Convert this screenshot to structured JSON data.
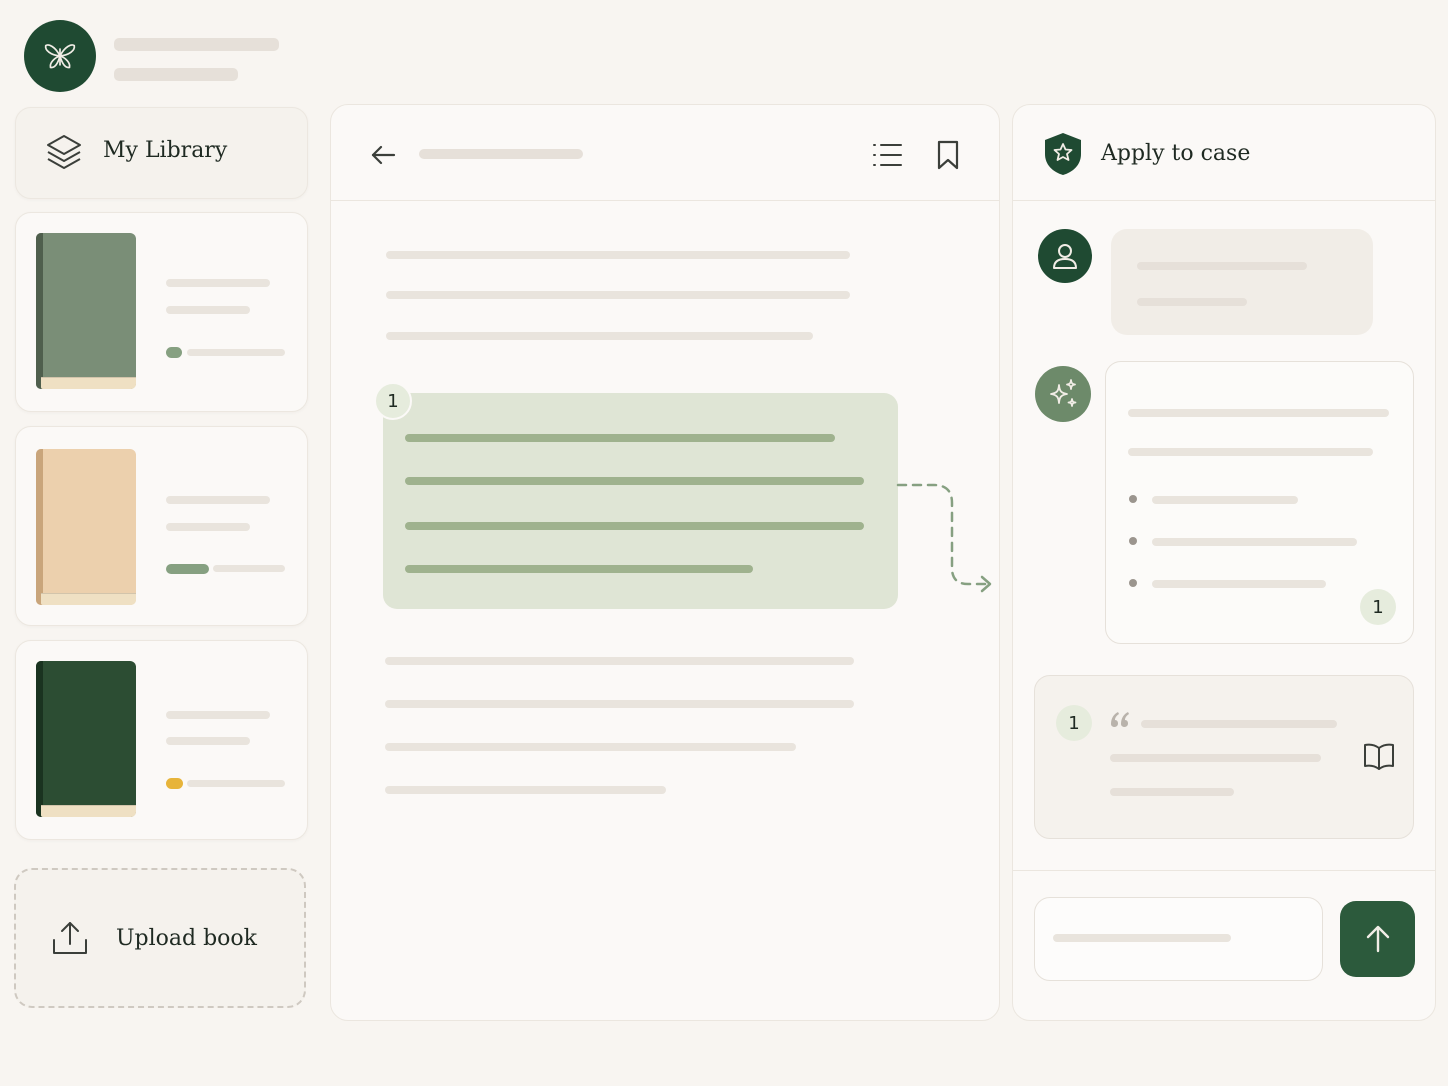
{
  "colors": {
    "brand": "#1f4a32",
    "accent": "#2c5a3c",
    "highlight": "#dfe5d5",
    "background": "#f8f5f1"
  },
  "brand": {
    "logo_icon": "butterfly-icon"
  },
  "sidebar": {
    "library": {
      "label": "My Library",
      "icon": "layers-icon"
    },
    "books": [
      {
        "cover_color": "#7a8e77",
        "spine_color": "#4f5f4d",
        "progress": 0.1,
        "progress_color": "#86a081"
      },
      {
        "cover_color": "#ecd0ad",
        "spine_color": "#c9a57b",
        "progress": 0.4,
        "progress_color": "#86a081"
      },
      {
        "cover_color": "#2c4d33",
        "spine_color": "#1a3320",
        "progress": 0.1,
        "progress_color": "#e7b43a"
      }
    ],
    "upload": {
      "label": "Upload book",
      "icon": "upload-icon"
    }
  },
  "reader": {
    "back_icon": "arrow-left-icon",
    "toc_icon": "list-icon",
    "bookmark_icon": "bookmark-icon",
    "highlight_badge": "1"
  },
  "chat": {
    "title": "Apply to case",
    "title_icon": "shield-icon",
    "user_avatar_icon": "user-icon",
    "assistant_avatar_icon": "sparkles-icon",
    "answer_citation": "1",
    "quote_citation": "1",
    "quote_icon": "quote-icon",
    "open_book_icon": "open-book-icon",
    "send_icon": "arrow-up-icon"
  }
}
